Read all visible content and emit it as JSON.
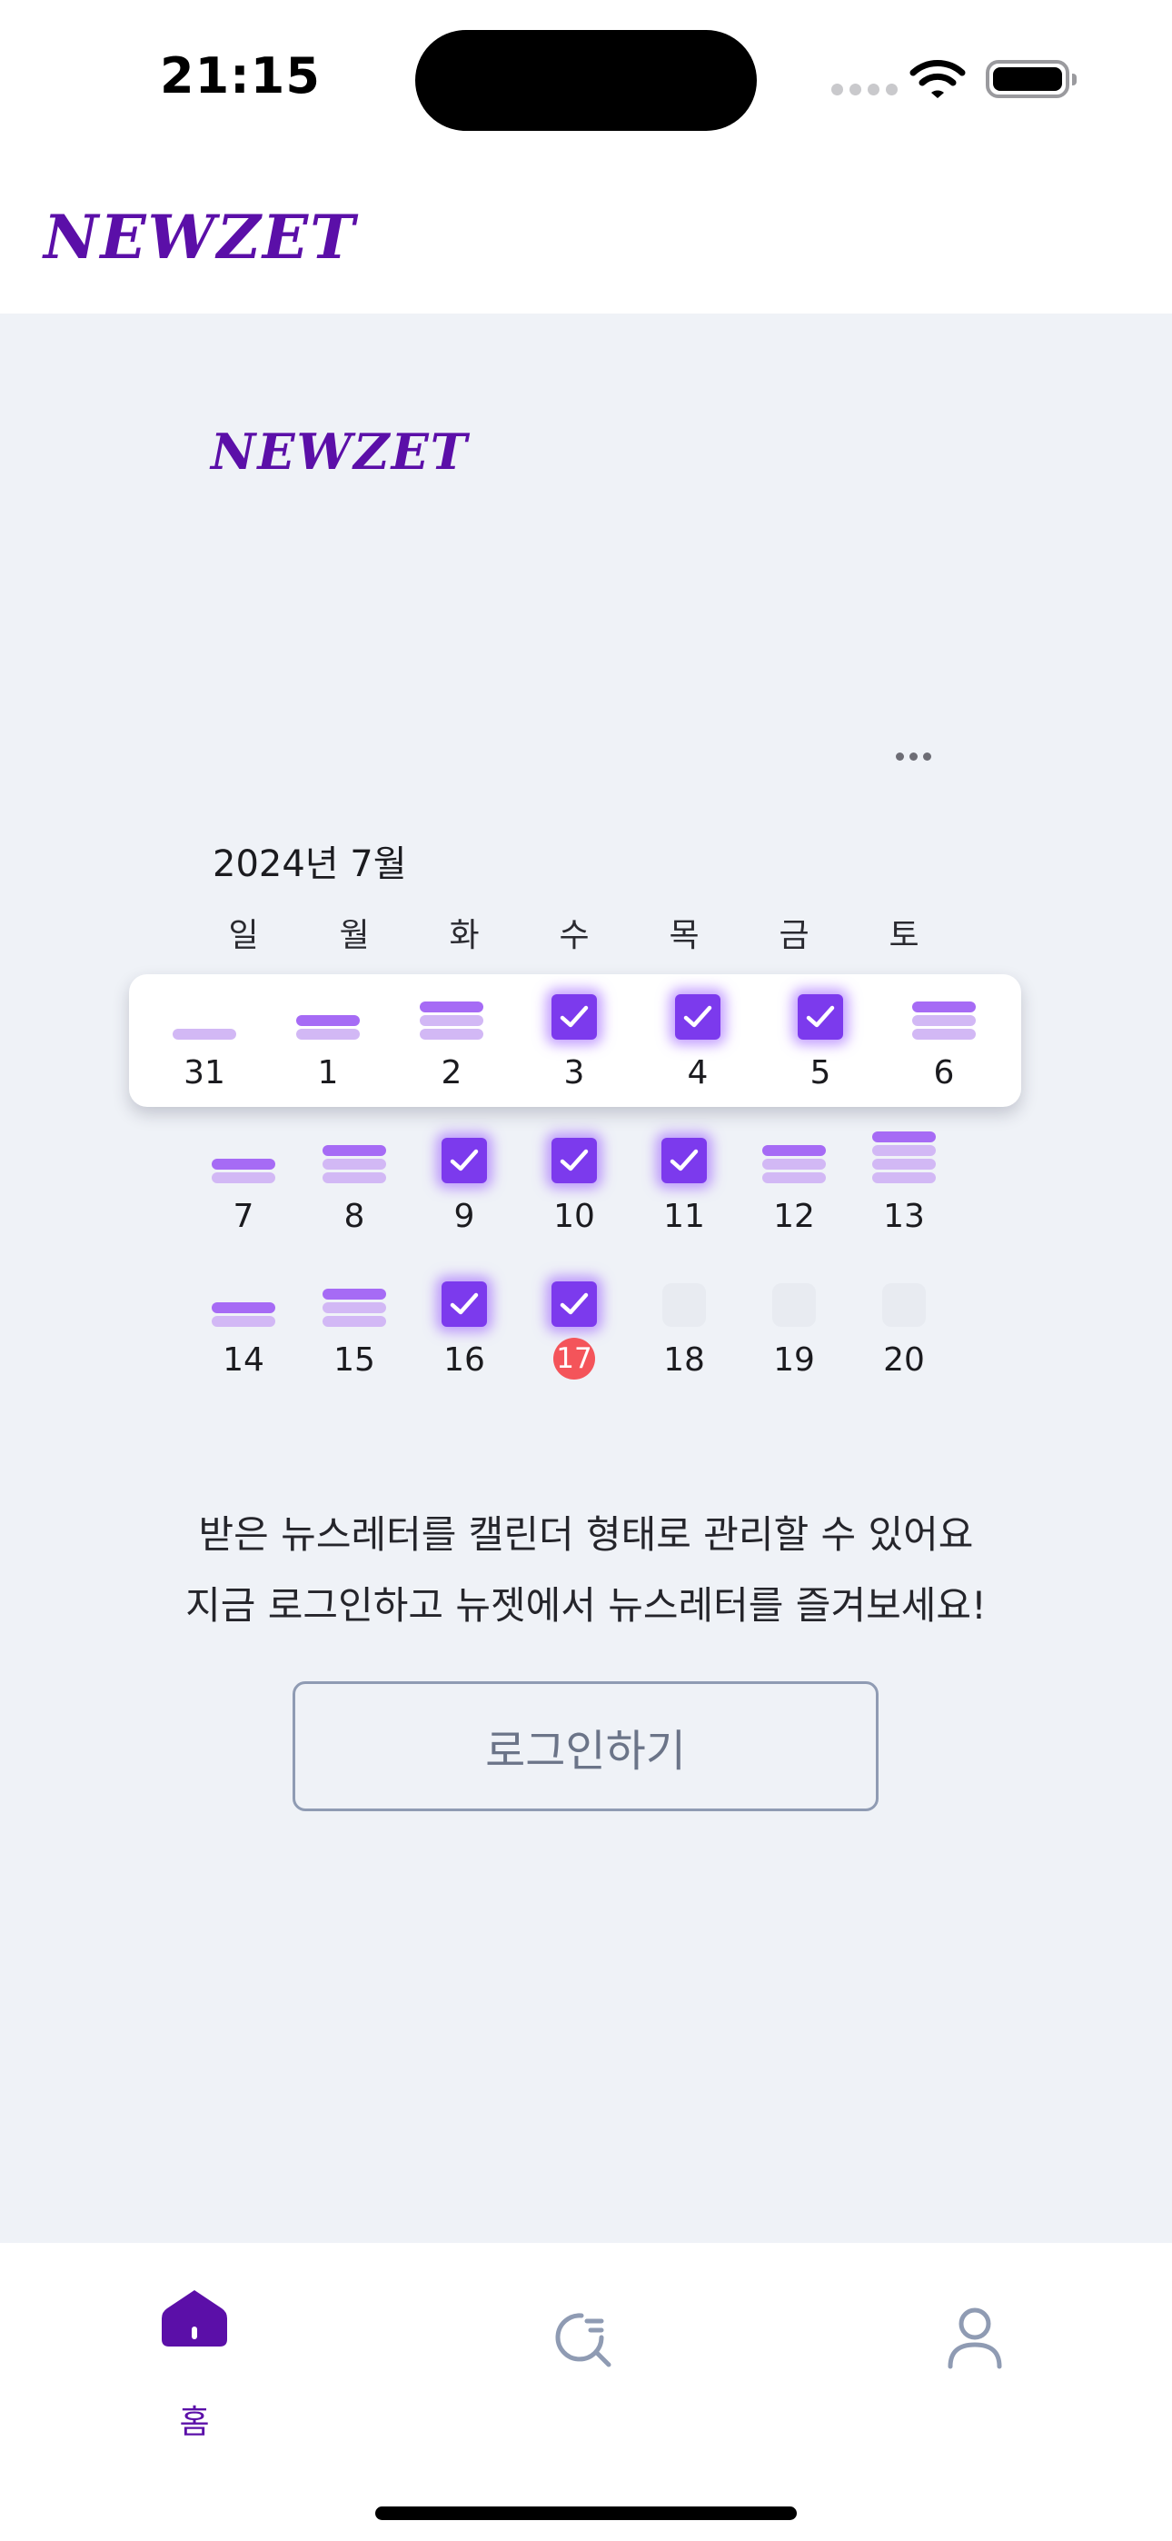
{
  "status_bar": {
    "time": "21:15"
  },
  "header": {
    "logo": "NEWZET"
  },
  "calendar": {
    "logo": "NEWZET",
    "month_label": "2024년 7월",
    "weekdays": [
      "일",
      "월",
      "화",
      "수",
      "목",
      "금",
      "토"
    ],
    "weeks": [
      [
        {
          "day": "31",
          "bars": 1
        },
        {
          "day": "1",
          "bars": 2
        },
        {
          "day": "2",
          "bars": 3
        },
        {
          "day": "3",
          "checked": true
        },
        {
          "day": "4",
          "checked": true
        },
        {
          "day": "5",
          "checked": true
        },
        {
          "day": "6",
          "bars": 3
        }
      ],
      [
        {
          "day": "7",
          "bars": 2
        },
        {
          "day": "8",
          "bars": 3
        },
        {
          "day": "9",
          "checked": true
        },
        {
          "day": "10",
          "checked": true
        },
        {
          "day": "11",
          "checked": true
        },
        {
          "day": "12",
          "bars": 3
        },
        {
          "day": "13",
          "bars": 4
        }
      ],
      [
        {
          "day": "14",
          "bars": 2
        },
        {
          "day": "15",
          "bars": 3
        },
        {
          "day": "16",
          "checked": true
        },
        {
          "day": "17",
          "checked": true,
          "today": true
        },
        {
          "day": "18",
          "future": true
        },
        {
          "day": "19",
          "future": true
        },
        {
          "day": "20",
          "future": true
        }
      ]
    ]
  },
  "description": {
    "line1": "받은 뉴스레터를 캘린더 형태로 관리할 수 있어요",
    "line2": "지금 로그인하고 뉴젯에서 뉴스레터를 즐겨보세요!"
  },
  "login_button": {
    "label": "로그인하기"
  },
  "tabbar": {
    "home_label": "홈",
    "active_color": "#5b0fa8",
    "inactive_color": "#8f9bb3",
    "icons": [
      "home-icon",
      "search-icon",
      "profile-icon"
    ]
  },
  "colors": {
    "brand": "#5b0fa8",
    "check": "#7c3aed",
    "bar_dark": "#a66bf5",
    "bar_light": "#d2b8f5",
    "today": "#f4545a",
    "background": "#eff2f7"
  }
}
